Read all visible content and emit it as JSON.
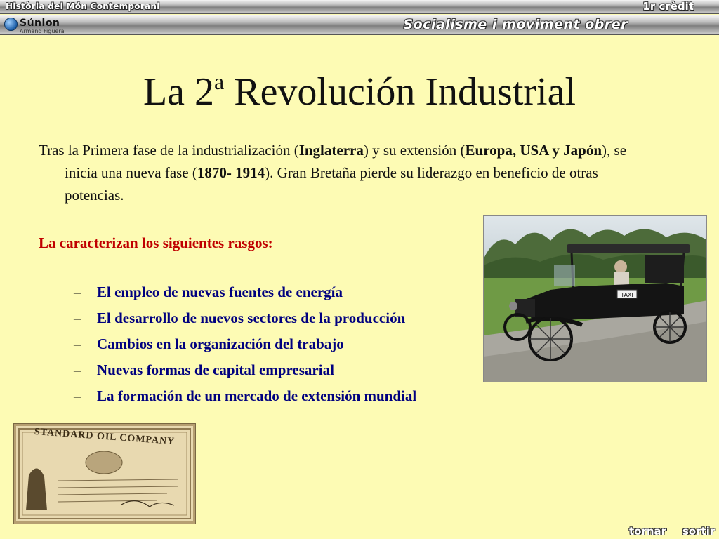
{
  "header": {
    "course": "Història del Món Contemporani",
    "credit": "1r crèdit",
    "unit": "Socialisme i moviment obrer",
    "logo_name": "Súnion",
    "logo_author": "Armand Figuera"
  },
  "slide": {
    "title_pre": "La 2",
    "title_sup": "a",
    "title_post": " Revolución Industrial",
    "intro": [
      {
        "t": "Tras la Primera fase de la industrialización (",
        "b": false
      },
      {
        "t": "Inglaterra",
        "b": true
      },
      {
        "t": ") y su extensión (",
        "b": false
      },
      {
        "t": "Europa, USA y Japón",
        "b": true
      },
      {
        "t": "), se inicia una nueva fase (",
        "b": false
      },
      {
        "t": "1870- 1914",
        "b": true
      },
      {
        "t": "). Gran Bretaña pierde su liderazgo en beneficio de otras potencias.",
        "b": false
      }
    ],
    "lead": "La caracterizan los siguientes rasgos:",
    "dash": "–",
    "traits": [
      "El empleo de nuevas fuentes de energía",
      "El desarrollo de nuevos sectores de la producción",
      "Cambios en la organización del trabajo",
      "Nuevas formas de capital empresarial",
      "La formación de un mercado de extensión mundial"
    ],
    "car_plate": "TAXI",
    "cert_title": "STANDARD OIL COMPANY"
  },
  "nav": {
    "back": "tornar",
    "exit": "sortir"
  }
}
